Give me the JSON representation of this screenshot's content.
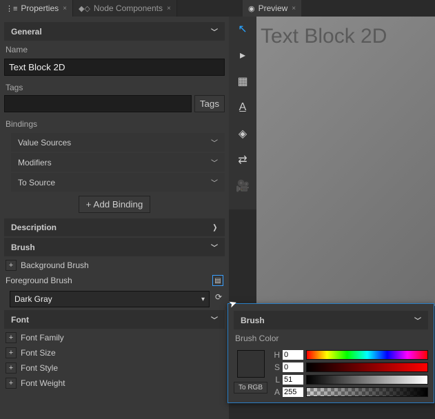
{
  "tabs": {
    "properties": "Properties",
    "nodeComponents": "Node Components",
    "preview": "Preview"
  },
  "sections": {
    "general": "General",
    "description": "Description",
    "brush": "Brush",
    "font": "Font"
  },
  "fields": {
    "name_label": "Name",
    "name_value": "Text Block 2D",
    "tags_label": "Tags",
    "tags_button": "Tags",
    "bindings_label": "Bindings",
    "value_sources": "Value Sources",
    "modifiers": "Modifiers",
    "to_source": "To Source",
    "add_binding": "+  Add Binding",
    "background_brush": "Background Brush",
    "foreground_brush": "Foreground Brush",
    "brush_value": "Dark Gray",
    "font_family": "Font Family",
    "font_size": "Font Size",
    "font_style": "Font Style",
    "font_weight": "Font Weight"
  },
  "canvas": {
    "text": "Text Block 2D"
  },
  "flyout": {
    "brush_hdr": "Brush",
    "brush_color_label": "Brush Color",
    "to_rgb": "To RGB",
    "h_label": "H",
    "h_value": "0",
    "s_label": "S",
    "s_value": "0",
    "l_label": "L",
    "l_value": "51",
    "a_label": "A",
    "a_value": "255"
  }
}
